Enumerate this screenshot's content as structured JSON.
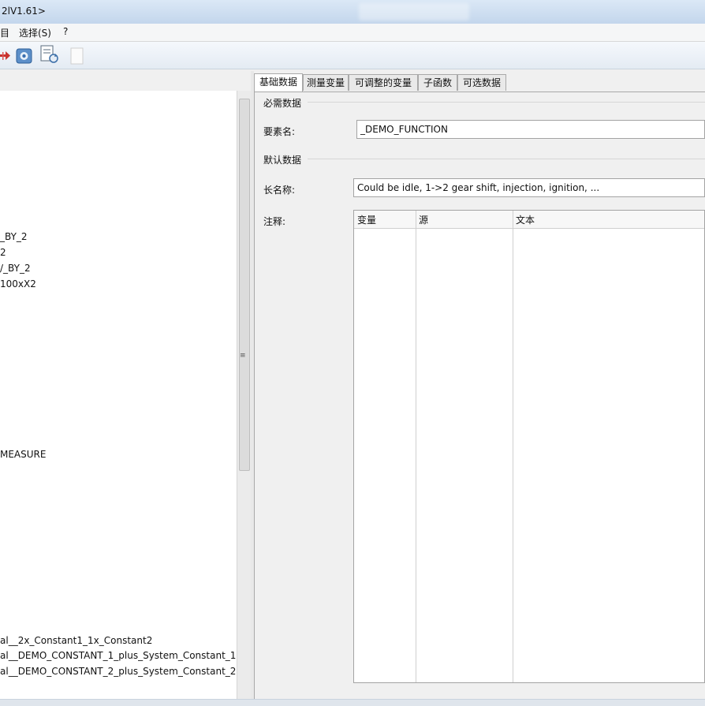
{
  "window": {
    "title": "2lV1.61>"
  },
  "menu": {
    "items": [
      "目",
      "选择(S)",
      "?"
    ]
  },
  "toolbar": {
    "icons": [
      "arrow-right-red-icon",
      "settings-icon",
      "document-refresh-icon",
      "blank-document-icon"
    ]
  },
  "tree": {
    "items": [
      "_BY_2",
      "2",
      "/_BY_2",
      "100xX2",
      "MEASURE",
      "al__2x_Constant1_1x_Constant2",
      "al__DEMO_CONSTANT_1_plus_System_Constant_1",
      "al__DEMO_CONSTANT_2_plus_System_Constant_2"
    ]
  },
  "tabs": [
    "基础数据",
    "测量变量",
    "可调整的变量",
    "子函数",
    "可选数据"
  ],
  "form": {
    "required_section": "必需数据",
    "element_name_label": "要素名:",
    "element_name_value": "_DEMO_FUNCTION",
    "default_section": "默认数据",
    "long_name_label": "长名称:",
    "long_name_value": "Could be idle, 1->2 gear shift, injection, ignition, ...",
    "comment_label": "注释:",
    "grid_headers": [
      "变量",
      "源",
      "文本"
    ]
  }
}
